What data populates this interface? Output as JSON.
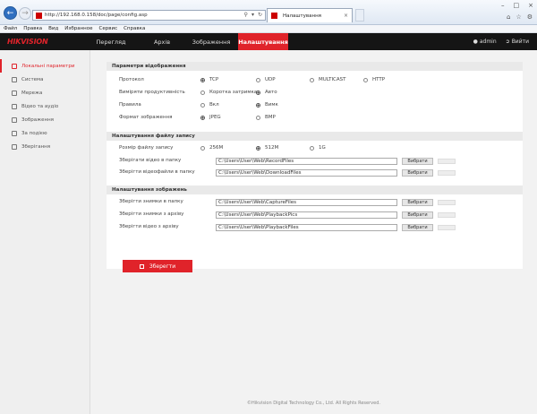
{
  "browser": {
    "address": "http://192.168.0.158/doc/page/config.asp",
    "tab_title": "Налаштування",
    "menu": [
      "Файл",
      "Правка",
      "Вид",
      "Избранное",
      "Сервис",
      "Справка"
    ]
  },
  "header": {
    "logo": "HIKVISION",
    "nav": {
      "preview": "Перегляд",
      "archive": "Архів",
      "images": "Зображення",
      "settings": "Налаштування"
    },
    "user": "admin",
    "logout": "Вийти"
  },
  "sidebar": {
    "items": [
      "Локальні параметри",
      "Система",
      "Мережа",
      "Відео та аудіо",
      "Зображення",
      "За подією",
      "Зберігання"
    ]
  },
  "sections": {
    "display": {
      "title": "Параметри відображення",
      "protocol": {
        "label": "Протокол",
        "options": [
          "TCP",
          "UDP",
          "MULTICAST",
          "HTTP"
        ],
        "selected": "TCP"
      },
      "performance": {
        "label": "Виміряти продуктивність",
        "options": [
          "Коротка затримка",
          "Авто"
        ],
        "selected": "Авто"
      },
      "rules": {
        "label": "Правила",
        "options": [
          "Вкл",
          "Вимк"
        ],
        "selected": "Вимк"
      },
      "format": {
        "label": "Формат зображення",
        "options": [
          "JPEG",
          "BMP"
        ],
        "selected": "JPEG"
      }
    },
    "record": {
      "title": "Налаштування файлу запису",
      "size": {
        "label": "Розмір файлу запису",
        "options": [
          "256M",
          "512M",
          "1G"
        ],
        "selected": "512M"
      },
      "save_video": {
        "label": "Зберігати відео в папку",
        "value": "C:\\Users\\User\\Web\\RecordFiles"
      },
      "save_downloads": {
        "label": "Зберігти відеофайли в папку",
        "value": "C:\\Users\\User\\Web\\DownloadFiles"
      }
    },
    "pictures": {
      "title": "Налаштування зображень",
      "snapshots": {
        "label": "Зберігти знимки в папку",
        "value": "C:\\Users\\User\\Web\\CaptureFiles"
      },
      "archive_pics": {
        "label": "Зберігти знимки з архіву",
        "value": "C:\\Users\\User\\Web\\PlaybackPics"
      },
      "archive_video": {
        "label": "Зберігти відео з архіву",
        "value": "C:\\Users\\User\\Web\\PlaybackFiles"
      }
    },
    "browse_label": "Вибрати"
  },
  "save_label": "Зберегти",
  "footer": "©Hikvision Digital Technology Co., Ltd. All Rights Reserved.",
  "colors": {
    "accent": "#e0232a",
    "header_bg": "#151515"
  }
}
